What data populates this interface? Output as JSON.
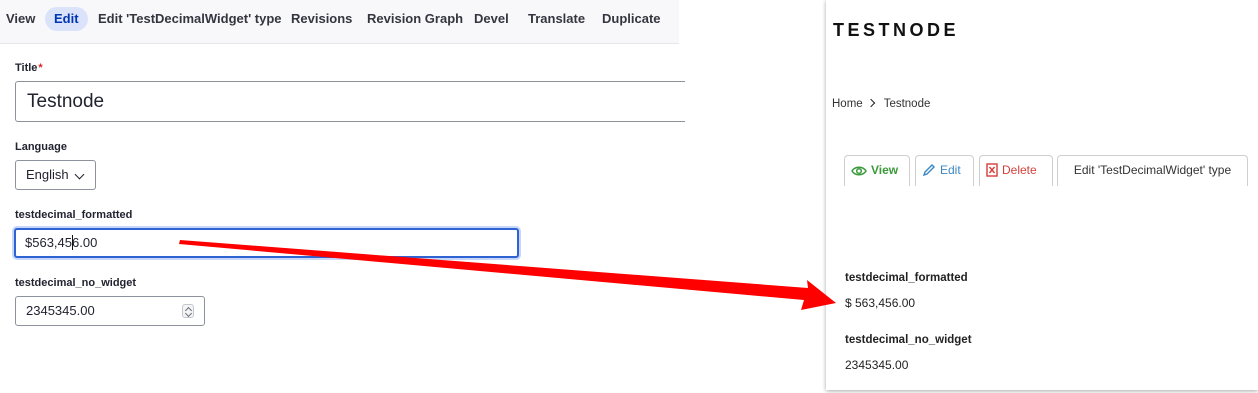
{
  "admin": {
    "tabs": [
      {
        "label": "View"
      },
      {
        "label": "Edit"
      },
      {
        "label": "Edit 'TestDecimalWidget' type"
      },
      {
        "label": "Revisions"
      },
      {
        "label": "Revision Graph"
      },
      {
        "label": "Devel"
      },
      {
        "label": "Translate"
      },
      {
        "label": "Duplicate"
      }
    ],
    "title_label": "Title",
    "required_mark": "*",
    "title_value": "Testnode",
    "language_label": "Language",
    "language_value": "English",
    "formatted_label": "testdecimal_formatted",
    "formatted_value_before_caret": "$563,45",
    "formatted_value_after_caret": "6.00",
    "no_widget_label": "testdecimal_no_widget",
    "no_widget_value": "2345345.00"
  },
  "view": {
    "site_name": "TESTNODE",
    "breadcrumb": {
      "home": "Home",
      "current": "Testnode"
    },
    "tabs": {
      "view": "View",
      "edit": "Edit",
      "delete": "Delete",
      "edit_type": "Edit 'TestDecimalWidget' type"
    },
    "formatted_label": "testdecimal_formatted",
    "formatted_value": "$ 563,456.00",
    "no_widget_label": "testdecimal_no_widget",
    "no_widget_value": "2345345.00"
  },
  "colors": {
    "arrow": "#ff0000",
    "active_tab_bg": "#dbe3fb",
    "focus_border": "#2f63d4",
    "view_tab": "#3a9a3a",
    "edit_tab": "#3b88c4",
    "delete_tab": "#d43f3a"
  }
}
